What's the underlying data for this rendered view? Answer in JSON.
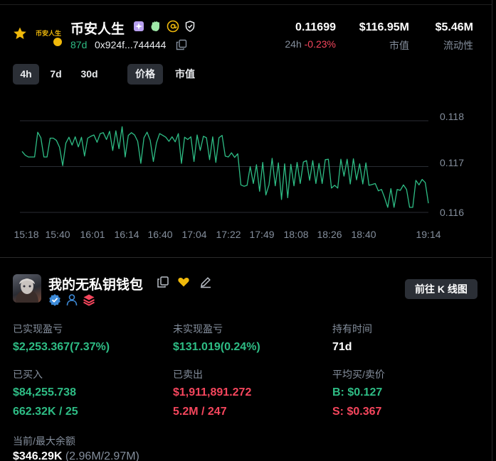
{
  "token": {
    "name": "币安人生",
    "logo_text": "币安人生",
    "age": "87d",
    "address": "0x924f...744444",
    "icons": [
      "star-icon",
      "sparkle-icon",
      "wave-hand-icon",
      "at-sign-icon",
      "verified-shield-icon",
      "copy-icon"
    ]
  },
  "stats": {
    "price": "0.11699",
    "change_label": "24h",
    "change": "-0.23%",
    "market_cap": "$116.95M",
    "market_cap_label": "市值",
    "liquidity": "$5.46M",
    "liquidity_label": "流动性"
  },
  "tabs": {
    "ranges": [
      "4h",
      "7d",
      "30d"
    ],
    "metrics": [
      "价格",
      "市值"
    ],
    "active_range": "4h",
    "active_metric": "价格"
  },
  "chart_data": {
    "type": "line",
    "title": "",
    "xlabel": "",
    "ylabel": "",
    "ylim": [
      0.1159,
      0.1181
    ],
    "yticks": [
      "0.118",
      "0.117",
      "0.116"
    ],
    "xticks": [
      "15:18",
      "15:40",
      "16:01",
      "16:14",
      "16:40",
      "17:04",
      "17:22",
      "17:49",
      "18:08",
      "18:26",
      "18:40",
      "19:14"
    ],
    "color": "#2ebd85",
    "series": [
      {
        "values": [
          0.11733,
          0.11725,
          0.11721,
          0.11721,
          0.11721,
          0.11775,
          0.11763,
          0.11721,
          0.11721,
          0.11762,
          0.11762,
          0.11757,
          0.11742,
          0.11702,
          0.11751,
          0.11764,
          0.11747,
          0.11765,
          0.11743,
          0.11764,
          0.11723,
          0.11762,
          0.11766,
          0.11769,
          0.11753,
          0.11772,
          0.11774,
          0.11759,
          0.11777,
          0.11735,
          0.11778,
          0.11739,
          0.11787,
          0.11721,
          0.11768,
          0.11774,
          0.11769,
          0.11755,
          0.11707,
          0.11763,
          0.11775,
          0.11757,
          0.11711,
          0.11752,
          0.11772,
          0.11768,
          0.11764,
          0.11755,
          0.11765,
          0.11754,
          0.11772,
          0.11707,
          0.11764,
          0.11759,
          0.11765,
          0.11711,
          0.11769,
          0.11735,
          0.11766,
          0.11763,
          0.11715,
          0.11765,
          0.11709,
          0.11763,
          0.11768,
          0.11723,
          0.11721,
          0.1173,
          0.1172,
          0.11728,
          0.1166,
          0.11657,
          0.11659,
          0.117,
          0.11663,
          0.11704,
          0.11646,
          0.11709,
          0.11638,
          0.1166,
          0.11718,
          0.11658,
          0.11708,
          0.11628,
          0.11706,
          0.11632,
          0.11705,
          0.11658,
          0.11709,
          0.11663,
          0.1171,
          0.11713,
          0.1167,
          0.11713,
          0.11663,
          0.11707,
          0.11663,
          0.11715,
          0.11716,
          0.11653,
          0.11659,
          0.11653,
          0.11716,
          0.11679,
          0.11716,
          0.11662,
          0.11717,
          0.11671,
          0.11706,
          0.11662,
          0.11708,
          0.11659,
          0.11661,
          0.11663,
          0.11647,
          0.1165,
          0.11632,
          0.11611,
          0.11652,
          0.11611,
          0.1165,
          0.11648,
          0.1166,
          0.1165,
          0.11611,
          0.11611,
          0.1167,
          0.1166,
          0.11672,
          0.11665,
          0.1162
        ]
      }
    ]
  },
  "wallet": {
    "name": "我的无私钥钱包",
    "button": "前往 K 线图",
    "fields": {
      "realized_pnl_label": "已实现盈亏",
      "realized_pnl": "$2,253.367(7.37%)",
      "unrealized_pnl_label": "未实现盈亏",
      "unrealized_pnl": "$131.019(0.24%)",
      "hold_time_label": "持有时间",
      "hold_time": "71d",
      "bought_label": "已买入",
      "bought_value": "$84,255.738",
      "bought_detail": "662.32K / 25",
      "sold_label": "已卖出",
      "sold_value": "$1,911,891.272",
      "sold_detail": "5.2M / 247",
      "avg_label": "平均买/卖价",
      "avg_buy": "B: $0.127",
      "avg_sell": "S: $0.367",
      "balance_label": "当前/最大余额",
      "balance_value": "$346.29K",
      "balance_detail": "(2.96M/2.97M)"
    }
  }
}
